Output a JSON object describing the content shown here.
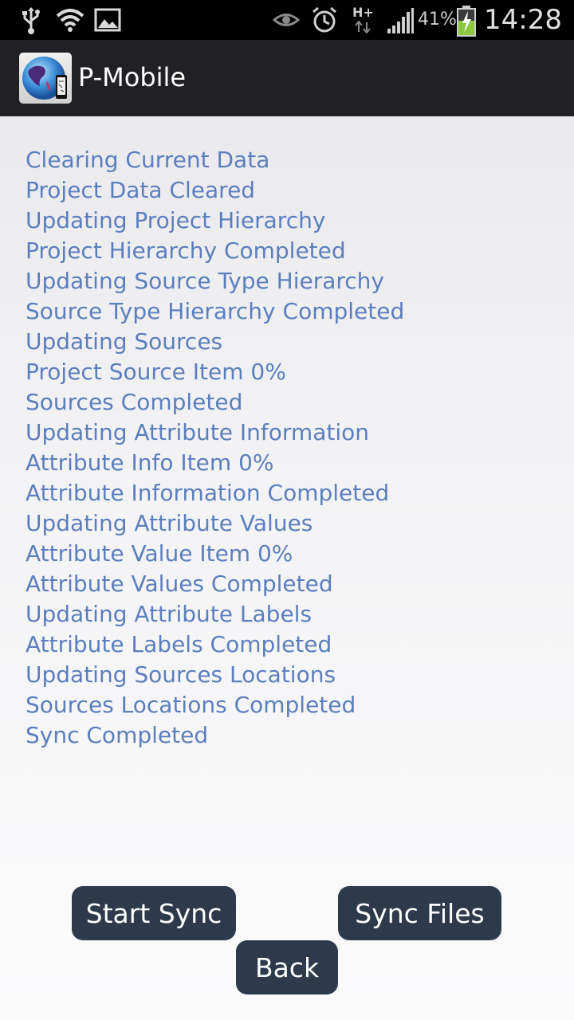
{
  "status_bar": {
    "icons": [
      "usb-icon",
      "wifi-icon",
      "image-icon",
      "eye-icon",
      "alarm-icon",
      "hplus-data-icon",
      "signal-icon",
      "battery-charging-icon"
    ],
    "network_label": "H+",
    "battery_percent": "41%",
    "time": "14:28"
  },
  "action_bar": {
    "title": "P-Mobile",
    "icon": "app-globe-icon"
  },
  "log": {
    "lines": [
      "Clearing Current Data",
      "Project Data Cleared",
      "Updating Project Hierarchy",
      "Project Hierarchy Completed",
      "Updating Source Type Hierarchy",
      "Source Type Hierarchy Completed",
      "Updating Sources",
      "Project Source Item 0%",
      "Sources Completed",
      "Updating Attribute Information",
      "Attribute Info Item 0%",
      "Attribute Information Completed",
      "Updating Attribute Values",
      "Attribute Value Item 0%",
      "Attribute Values Completed",
      "Updating Attribute Labels",
      "Attribute Labels Completed",
      "Updating Sources Locations",
      "Sources Locations Completed",
      "Sync Completed"
    ]
  },
  "buttons": {
    "start_sync": "Start Sync",
    "sync_files": "Sync Files",
    "back": "Back"
  },
  "colors": {
    "status_bar_bg": "#000000",
    "action_bar_bg": "#212125",
    "log_text": "#5b7fbc",
    "button_bg": "#2c3a4c",
    "button_text": "#ffffff"
  }
}
